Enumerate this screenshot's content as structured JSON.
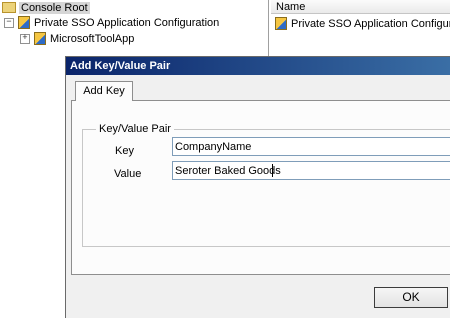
{
  "tree": {
    "root_label": "Console Root",
    "items": [
      {
        "label": "Private SSO Application Configuration",
        "expander": "−",
        "icon": "sso-application-icon"
      },
      {
        "label": "MicrosoftToolApp",
        "expander": "+",
        "icon": "sso-application-icon"
      }
    ]
  },
  "list": {
    "header": "Name",
    "items": [
      {
        "label": "Private SSO Application Configura..."
      }
    ]
  },
  "dialog": {
    "title": "Add Key/Value Pair",
    "tab_label": "Add Key",
    "group_label": "Key/Value Pair",
    "key_label": "Key",
    "key_value": "CompanyName",
    "value_label": "Value",
    "value_value": "Seroter Baked Goods",
    "ok_label": "OK"
  },
  "colors": {
    "titlebar_start": "#0a246a",
    "titlebar_end": "#3a6ea5",
    "dialog_bg": "#f0f0f0",
    "input_border": "#7f9db9"
  }
}
